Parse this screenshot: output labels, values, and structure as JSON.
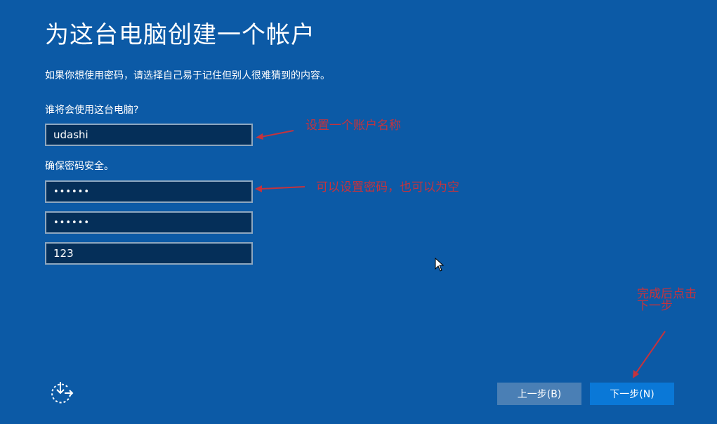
{
  "page": {
    "title": "为这台电脑创建一个帐户",
    "subtitle": "如果你想使用密码，请选择自己易于记住但别人很难猜到的内容。"
  },
  "form": {
    "username_label": "谁将会使用这台电脑?",
    "username_value": "udashi",
    "password_label": "确保密码安全。",
    "password_value": "••••••",
    "confirm_value": "••••••",
    "hint_value": "123"
  },
  "annotations": {
    "username_note": "设置一个账户名称",
    "password_note": "可以设置密码，也可以为空",
    "next_note_line1": "完成后点击",
    "next_note_line2": "下一步"
  },
  "buttons": {
    "back_label": "上一步(B)",
    "next_label": "下一步(N)"
  },
  "icons": {
    "ease_of_access": "ease-of-access-icon",
    "cursor": "mouse-cursor-icon"
  },
  "colors": {
    "background": "#0c5aa6",
    "input_bg": "#052f59",
    "input_border": "#8ea7bf",
    "annotation": "#c5333d",
    "back_button": "#4a7fb5",
    "next_button": "#0a78d7"
  }
}
